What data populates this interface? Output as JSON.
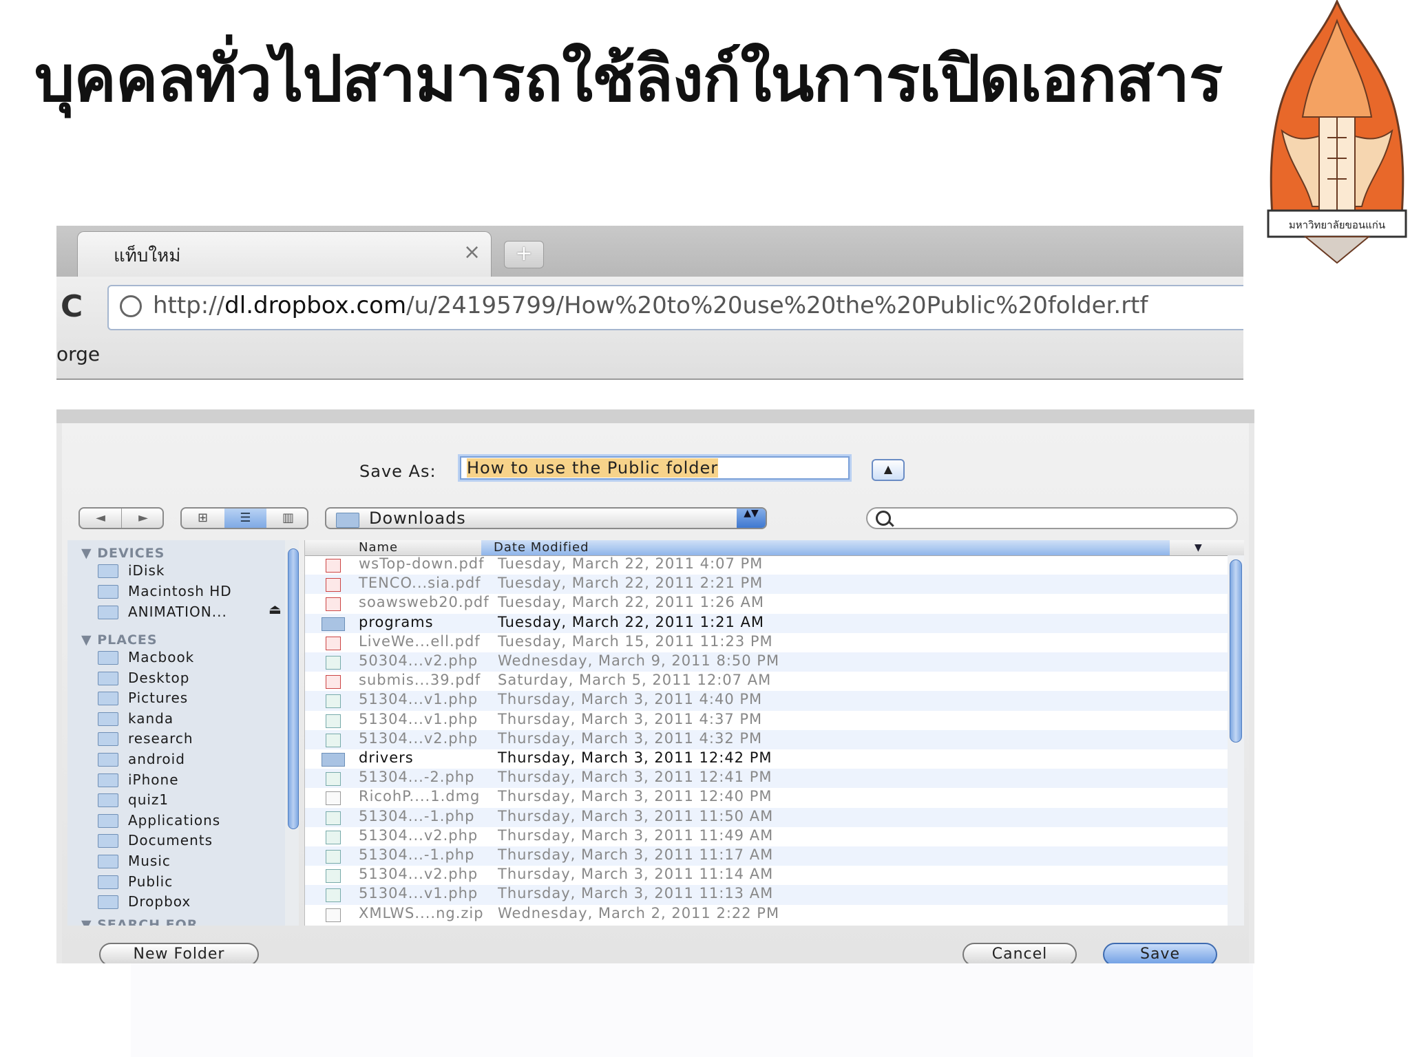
{
  "slide": {
    "title": "บุคคลทั่วไปสามารถใช้ลิงก์ในการเปิดเอกสาร",
    "logo_text": "มหาวิทยาลัยขอนแก่น"
  },
  "browser": {
    "tab_title": "แท็บใหม่",
    "tab_close": "×",
    "new_tab": "+",
    "reload": "C",
    "url_scheme": "http://",
    "url_host": "dl.dropbox.com",
    "url_path": "/u/24195799/How%20to%20use%20the%20Public%20folder.rtf",
    "bookmark_fragment": "orge"
  },
  "dialog": {
    "save_as_label": "Save As:",
    "save_as_value": "How to use the Public folder",
    "expand": "▲",
    "nav_back": "◄",
    "nav_fwd": "►",
    "view_icon": "⊞",
    "view_list": "☰",
    "view_columns": "▥",
    "location": "Downloads",
    "location_arrows": "▲▼",
    "columns": {
      "name": "Name",
      "date": "Date Modified",
      "sort": "▼"
    },
    "sidebar": {
      "devices_header": "▼ DEVICES",
      "devices": [
        "iDisk",
        "Macintosh HD",
        "ANIMATION..."
      ],
      "eject": "⏏",
      "places_header": "▼ PLACES",
      "places": [
        "Macbook",
        "Desktop",
        "Pictures",
        "kanda",
        "research",
        "android",
        "iPhone",
        "quiz1",
        "Applications",
        "Documents",
        "Music",
        "Public",
        "Dropbox"
      ],
      "search_header": "▼ SEARCH FOR"
    },
    "files": [
      {
        "name": "wsTop-down.pdf",
        "date": "Tuesday, March 22, 2011 4:07 PM",
        "kind": "pdf"
      },
      {
        "name": "TENCO...sia.pdf",
        "date": "Tuesday, March 22, 2011 2:21 PM",
        "kind": "pdf"
      },
      {
        "name": "soawsweb20.pdf",
        "date": "Tuesday, March 22, 2011 1:26 AM",
        "kind": "pdf"
      },
      {
        "name": "programs",
        "date": "Tuesday, March 22, 2011 1:21 AM",
        "kind": "folder"
      },
      {
        "name": "LiveWe...ell.pdf",
        "date": "Tuesday, March 15, 2011 11:23 PM",
        "kind": "pdf"
      },
      {
        "name": "50304...v2.php",
        "date": "Wednesday, March 9, 2011 8:50 PM",
        "kind": "php"
      },
      {
        "name": "submis...39.pdf",
        "date": "Saturday, March 5, 2011 12:07 AM",
        "kind": "pdf"
      },
      {
        "name": "51304...v1.php",
        "date": "Thursday, March 3, 2011 4:40 PM",
        "kind": "php"
      },
      {
        "name": "51304...v1.php",
        "date": "Thursday, March 3, 2011 4:37 PM",
        "kind": "php"
      },
      {
        "name": "51304...v2.php",
        "date": "Thursday, March 3, 2011 4:32 PM",
        "kind": "php"
      },
      {
        "name": "drivers",
        "date": "Thursday, March 3, 2011 12:42 PM",
        "kind": "folder"
      },
      {
        "name": "51304...-2.php",
        "date": "Thursday, March 3, 2011 12:41 PM",
        "kind": "php"
      },
      {
        "name": "RicohP....1.dmg",
        "date": "Thursday, March 3, 2011 12:40 PM",
        "kind": "dmg"
      },
      {
        "name": "51304...-1.php",
        "date": "Thursday, March 3, 2011 11:50 AM",
        "kind": "php"
      },
      {
        "name": "51304...v2.php",
        "date": "Thursday, March 3, 2011 11:49 AM",
        "kind": "php"
      },
      {
        "name": "51304...-1.php",
        "date": "Thursday, March 3, 2011 11:17 AM",
        "kind": "php"
      },
      {
        "name": "51304...v2.php",
        "date": "Thursday, March 3, 2011 11:14 AM",
        "kind": "php"
      },
      {
        "name": "51304...v1.php",
        "date": "Thursday, March 3, 2011 11:13 AM",
        "kind": "php"
      },
      {
        "name": "XMLWS....ng.zip",
        "date": "Wednesday, March 2, 2011 2:22 PM",
        "kind": "zip"
      }
    ],
    "buttons": {
      "new_folder": "New Folder",
      "cancel": "Cancel",
      "save": "Save"
    }
  }
}
